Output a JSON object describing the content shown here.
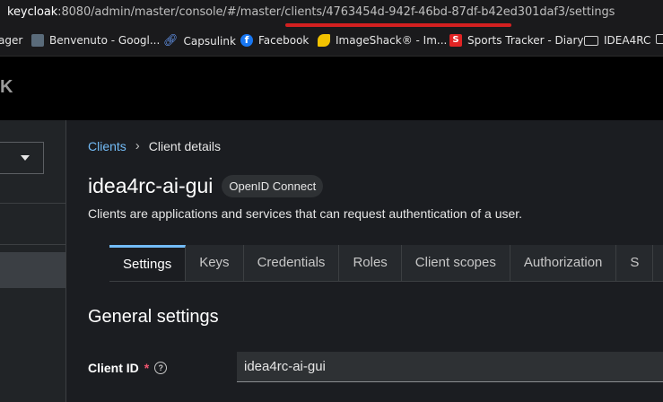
{
  "browser": {
    "url_host": "keycloak",
    "url_rest": ":8080/admin/master/console/#/master/clients/4763454d-942f-46bd-87df-b42ed301daf3/settings",
    "bookmarks": [
      {
        "label": "ager",
        "icon": "none"
      },
      {
        "label": "Benvenuto - Googl...",
        "icon": "bookmark-icon"
      },
      {
        "label": "Capsulink",
        "icon": "link-icon"
      },
      {
        "label": "Facebook",
        "icon": "facebook-icon"
      },
      {
        "label": "ImageShack® - Im...",
        "icon": "imageshack-icon"
      },
      {
        "label": "Sports Tracker - Diary",
        "icon": "sports-tracker-icon"
      },
      {
        "label": "IDEA4RC",
        "icon": "folder-icon"
      }
    ]
  },
  "header": {
    "brand_fragment": "K"
  },
  "breadcrumb": {
    "root": "Clients",
    "current": "Client details"
  },
  "client": {
    "title": "idea4rc-ai-gui",
    "protocol_badge": "OpenID Connect",
    "description": "Clients are applications and services that can request authentication of a user."
  },
  "tabs": [
    "Settings",
    "Keys",
    "Credentials",
    "Roles",
    "Client scopes",
    "Authorization",
    "S"
  ],
  "form": {
    "section_title": "General settings",
    "client_id_label": "Client ID",
    "required_mark": "*",
    "client_id_value": "idea4rc-ai-gui"
  },
  "colors": {
    "accent": "#73bcf7",
    "required": "#f0556f",
    "url_highlight": "#d32020"
  }
}
